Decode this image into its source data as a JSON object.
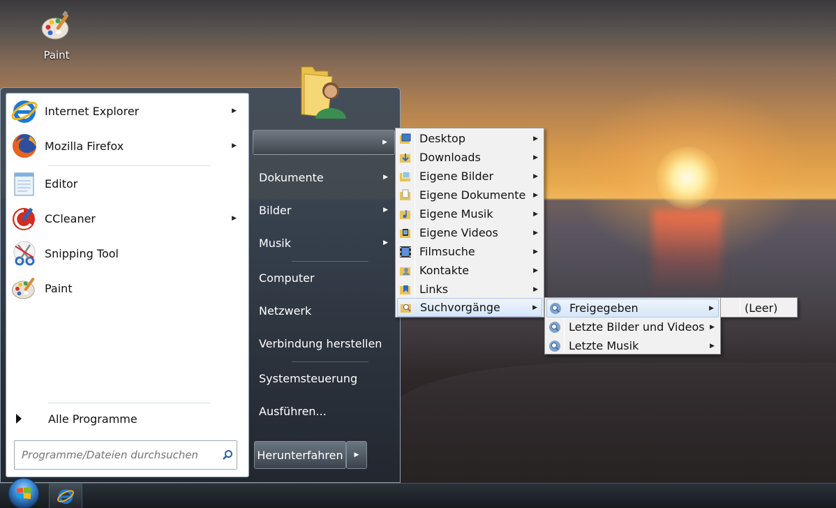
{
  "desktop": {
    "icons": [
      {
        "label": "Paint",
        "icon": "paint-palette-icon"
      }
    ]
  },
  "startmenu": {
    "programs": [
      {
        "label": "Internet Explorer",
        "icon": "internet-explorer-icon",
        "has_submenu": true
      },
      {
        "label": "Mozilla Firefox",
        "icon": "firefox-icon",
        "has_submenu": true
      },
      {
        "label": "Editor",
        "icon": "notepad-icon",
        "has_submenu": false
      },
      {
        "label": "CCleaner",
        "icon": "ccleaner-icon",
        "has_submenu": true
      },
      {
        "label": "Snipping Tool",
        "icon": "scissors-icon",
        "has_submenu": false
      },
      {
        "label": "Paint",
        "icon": "paint-palette-icon",
        "has_submenu": false
      }
    ],
    "all_programs": "Alle Programme",
    "search_placeholder": "Programme/Dateien durchsuchen",
    "right": {
      "user_folder_label": "",
      "items": [
        {
          "label": "Dokumente",
          "has_submenu": true
        },
        {
          "label": "Bilder",
          "has_submenu": true
        },
        {
          "label": "Musik",
          "has_submenu": true
        },
        {
          "label": "Computer",
          "has_submenu": false
        },
        {
          "label": "Netzwerk",
          "has_submenu": false
        },
        {
          "label": "Verbindung herstellen",
          "has_submenu": false
        },
        {
          "label": "Systemsteuerung",
          "has_submenu": false
        },
        {
          "label": "Ausführen...",
          "has_submenu": false
        }
      ],
      "shutdown_label": "Herunterfahren"
    }
  },
  "user_folder_menu": {
    "items": [
      {
        "label": "Desktop",
        "icon": "desktop-folder-icon"
      },
      {
        "label": "Downloads",
        "icon": "downloads-folder-icon"
      },
      {
        "label": "Eigene Bilder",
        "icon": "pictures-folder-icon"
      },
      {
        "label": "Eigene Dokumente",
        "icon": "documents-folder-icon"
      },
      {
        "label": "Eigene Musik",
        "icon": "music-folder-icon"
      },
      {
        "label": "Eigene Videos",
        "icon": "videos-folder-icon"
      },
      {
        "label": "Filmsuche",
        "icon": "film-icon"
      },
      {
        "label": "Kontakte",
        "icon": "contacts-folder-icon"
      },
      {
        "label": "Links",
        "icon": "links-folder-icon"
      },
      {
        "label": "Suchvorgänge",
        "icon": "searches-folder-icon"
      }
    ],
    "selected": "Suchvorgänge"
  },
  "searches_menu": {
    "items": [
      {
        "label": "Freigegeben",
        "icon": "saved-search-icon"
      },
      {
        "label": "Letzte Bilder und Videos",
        "icon": "saved-search-icon"
      },
      {
        "label": "Letzte Musik",
        "icon": "saved-search-icon"
      }
    ],
    "selected": "Freigegeben"
  },
  "shared_menu": {
    "empty_label": "(Leer)"
  },
  "colors": {
    "menu_highlight": "#d7e6f7",
    "startmenu_dark": "#2a3138",
    "orb_blue": "#3a89d6"
  }
}
